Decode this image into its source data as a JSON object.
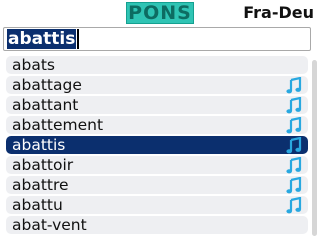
{
  "header": {
    "logo_text": "PONS",
    "language_pair": "Fra-Deu"
  },
  "search": {
    "value": "abattis"
  },
  "entries": [
    {
      "word": "abats",
      "has_audio": false,
      "selected": false
    },
    {
      "word": "abattage",
      "has_audio": true,
      "selected": false
    },
    {
      "word": "abattant",
      "has_audio": true,
      "selected": false
    },
    {
      "word": "abattement",
      "has_audio": true,
      "selected": false
    },
    {
      "word": "abattis",
      "has_audio": true,
      "selected": true
    },
    {
      "word": "abattoir",
      "has_audio": true,
      "selected": false
    },
    {
      "word": "abattre",
      "has_audio": true,
      "selected": false
    },
    {
      "word": "abattu",
      "has_audio": true,
      "selected": false
    },
    {
      "word": "abat-vent",
      "has_audio": false,
      "selected": false
    }
  ],
  "colors": {
    "selection": "#0b2f6e",
    "audio_icon": "#29a8e0",
    "logo_bg": "#2fc4b4"
  },
  "icons": {
    "audio": "music-note-icon"
  }
}
